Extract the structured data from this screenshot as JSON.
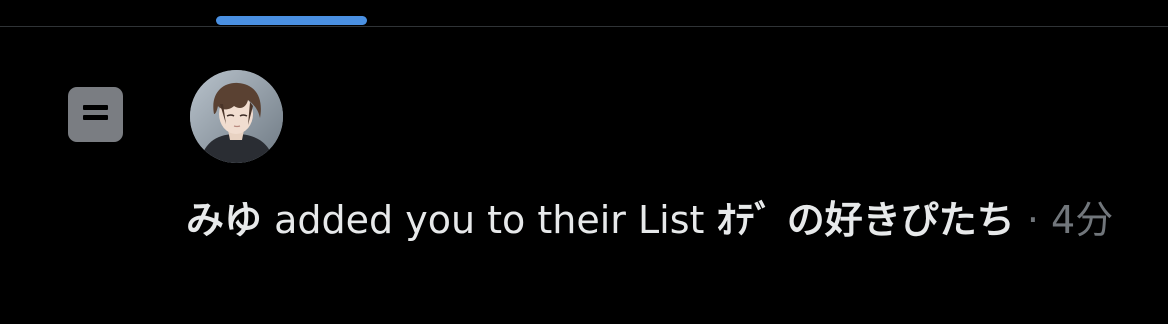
{
  "notification": {
    "type": "list-add",
    "user_name": "みゆ",
    "action_text": "added you to their List",
    "list_name": "ｵﾃﾞ の好きぴたち",
    "separator": "·",
    "timestamp": "4分"
  },
  "colors": {
    "background": "#000000",
    "tab_indicator": "#4a90e2",
    "list_icon_bg": "#7a7d82",
    "text_primary": "#e7e9ea",
    "text_secondary": "#71767b"
  },
  "icons": {
    "list_icon": "list-icon",
    "avatar": "user-avatar"
  }
}
